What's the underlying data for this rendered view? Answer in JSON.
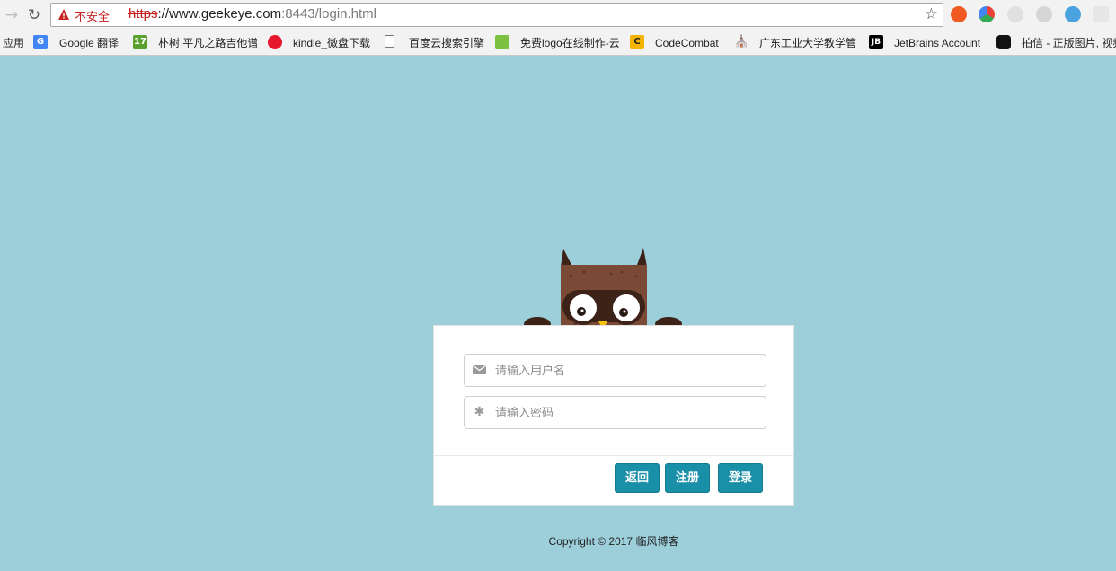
{
  "browser": {
    "security_label": "不安全",
    "url_scheme": "https",
    "url_host": "://www.geekeye.com",
    "url_rest": ":8443/login.html"
  },
  "bookmarks": [
    {
      "label": "应用"
    },
    {
      "label": "Google 翻译"
    },
    {
      "label": "朴树 平凡之路吉他谱"
    },
    {
      "label": "kindle_微盘下载"
    },
    {
      "label": "百度云搜索引擎"
    },
    {
      "label": "免费logo在线制作-云"
    },
    {
      "label": "CodeCombat"
    },
    {
      "label": "广东工业大学教学管"
    },
    {
      "label": "JetBrains Account"
    },
    {
      "label": "拍信 - 正版图片, 视频"
    }
  ],
  "login": {
    "username_placeholder": "请输入用户名",
    "password_placeholder": "请输入密码",
    "back_label": "返回",
    "register_label": "注册",
    "login_label": "登录"
  },
  "footer": {
    "copyright": "Copyright © 2017 临风博客"
  },
  "colors": {
    "page_background": "#9dcfda",
    "button": "#1a8fa8",
    "owl_body": "#7a4a36",
    "owl_dark": "#3d2218"
  }
}
